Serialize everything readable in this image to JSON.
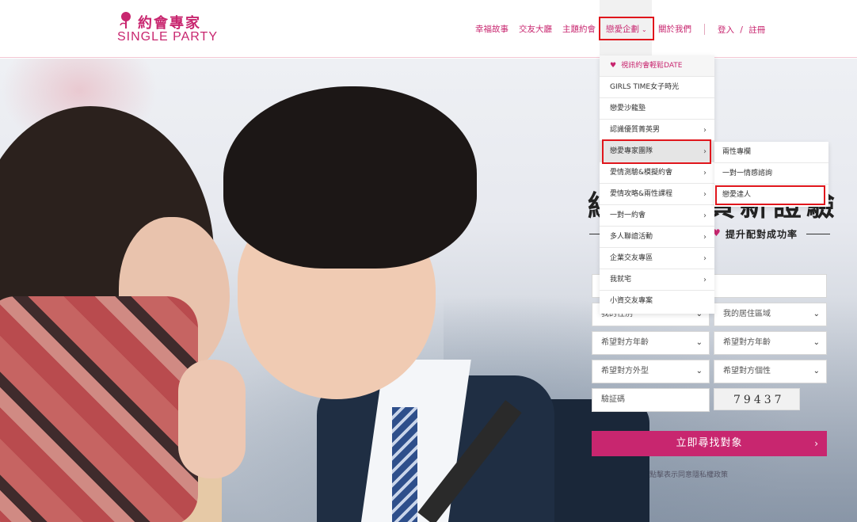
{
  "logo": {
    "cn": "約會專家",
    "en": "SINGLE PARTY"
  },
  "nav": {
    "items": [
      {
        "label": "幸福故事"
      },
      {
        "label": "交友大廳"
      },
      {
        "label": "主題約會"
      },
      {
        "label": "戀愛企劃",
        "chevron": "⌄"
      },
      {
        "label": "關於我們"
      }
    ],
    "login": "登入",
    "slash": "/",
    "register": "註冊"
  },
  "menu": {
    "items": [
      {
        "label": "視訊約會輕鬆DATE",
        "icon": "heart-icon"
      },
      {
        "label": "GIRLS TIME女子時光"
      },
      {
        "label": "戀愛沙龍塾"
      },
      {
        "label": "認識優質菁英男",
        "arrow": "›"
      },
      {
        "label": "戀愛專家團隊",
        "arrow": "›"
      },
      {
        "label": "愛情測驗&模擬約會",
        "arrow": "›"
      },
      {
        "label": "愛情攻略&兩性課程",
        "arrow": "›"
      },
      {
        "label": "一對一約會",
        "arrow": "›"
      },
      {
        "label": "多人聯誼活動",
        "arrow": "›"
      },
      {
        "label": "企業交友專區",
        "arrow": "›"
      },
      {
        "label": "我就宅",
        "arrow": "›"
      },
      {
        "label": "小資交友專案"
      }
    ],
    "submenu": [
      {
        "label": "兩性專欄"
      },
      {
        "label": "一對一情感諮詢"
      },
      {
        "label": "戀愛達人"
      }
    ]
  },
  "hero": {
    "headline_left": "線",
    "headline_right": "頁新證驗",
    "subheading": "提升配對成功率"
  },
  "form": {
    "my_gender": "我的性別",
    "my_area": "我的居住區域",
    "pref_age_1": "希望對方年齡",
    "pref_age_2": "希望對方年齡",
    "pref_look": "希望對方外型",
    "pref_personality": "希望對方個性",
    "captcha_placeholder": "驗証碼",
    "captcha_code": "79437",
    "submit": "立即尋找對象",
    "submit_arrow": "›",
    "privacy": "點擊表示同意隱私權政策"
  },
  "colors": {
    "brand": "#c8266f",
    "annotation": "#e0161c"
  }
}
